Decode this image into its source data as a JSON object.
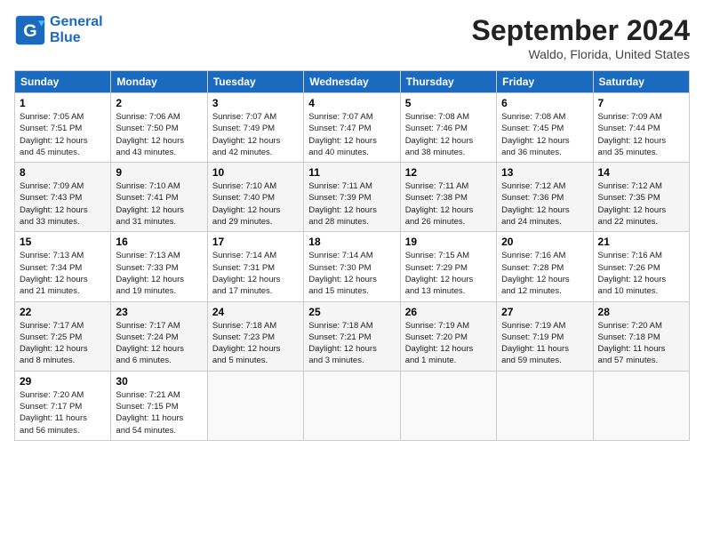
{
  "header": {
    "logo_line1": "General",
    "logo_line2": "Blue",
    "month_title": "September 2024",
    "location": "Waldo, Florida, United States"
  },
  "weekdays": [
    "Sunday",
    "Monday",
    "Tuesday",
    "Wednesday",
    "Thursday",
    "Friday",
    "Saturday"
  ],
  "weeks": [
    [
      {
        "day": "1",
        "sunrise": "7:05 AM",
        "sunset": "7:51 PM",
        "daylight": "12 hours and 45 minutes."
      },
      {
        "day": "2",
        "sunrise": "7:06 AM",
        "sunset": "7:50 PM",
        "daylight": "12 hours and 43 minutes."
      },
      {
        "day": "3",
        "sunrise": "7:07 AM",
        "sunset": "7:49 PM",
        "daylight": "12 hours and 42 minutes."
      },
      {
        "day": "4",
        "sunrise": "7:07 AM",
        "sunset": "7:47 PM",
        "daylight": "12 hours and 40 minutes."
      },
      {
        "day": "5",
        "sunrise": "7:08 AM",
        "sunset": "7:46 PM",
        "daylight": "12 hours and 38 minutes."
      },
      {
        "day": "6",
        "sunrise": "7:08 AM",
        "sunset": "7:45 PM",
        "daylight": "12 hours and 36 minutes."
      },
      {
        "day": "7",
        "sunrise": "7:09 AM",
        "sunset": "7:44 PM",
        "daylight": "12 hours and 35 minutes."
      }
    ],
    [
      {
        "day": "8",
        "sunrise": "7:09 AM",
        "sunset": "7:43 PM",
        "daylight": "12 hours and 33 minutes."
      },
      {
        "day": "9",
        "sunrise": "7:10 AM",
        "sunset": "7:41 PM",
        "daylight": "12 hours and 31 minutes."
      },
      {
        "day": "10",
        "sunrise": "7:10 AM",
        "sunset": "7:40 PM",
        "daylight": "12 hours and 29 minutes."
      },
      {
        "day": "11",
        "sunrise": "7:11 AM",
        "sunset": "7:39 PM",
        "daylight": "12 hours and 28 minutes."
      },
      {
        "day": "12",
        "sunrise": "7:11 AM",
        "sunset": "7:38 PM",
        "daylight": "12 hours and 26 minutes."
      },
      {
        "day": "13",
        "sunrise": "7:12 AM",
        "sunset": "7:36 PM",
        "daylight": "12 hours and 24 minutes."
      },
      {
        "day": "14",
        "sunrise": "7:12 AM",
        "sunset": "7:35 PM",
        "daylight": "12 hours and 22 minutes."
      }
    ],
    [
      {
        "day": "15",
        "sunrise": "7:13 AM",
        "sunset": "7:34 PM",
        "daylight": "12 hours and 21 minutes."
      },
      {
        "day": "16",
        "sunrise": "7:13 AM",
        "sunset": "7:33 PM",
        "daylight": "12 hours and 19 minutes."
      },
      {
        "day": "17",
        "sunrise": "7:14 AM",
        "sunset": "7:31 PM",
        "daylight": "12 hours and 17 minutes."
      },
      {
        "day": "18",
        "sunrise": "7:14 AM",
        "sunset": "7:30 PM",
        "daylight": "12 hours and 15 minutes."
      },
      {
        "day": "19",
        "sunrise": "7:15 AM",
        "sunset": "7:29 PM",
        "daylight": "12 hours and 13 minutes."
      },
      {
        "day": "20",
        "sunrise": "7:16 AM",
        "sunset": "7:28 PM",
        "daylight": "12 hours and 12 minutes."
      },
      {
        "day": "21",
        "sunrise": "7:16 AM",
        "sunset": "7:26 PM",
        "daylight": "12 hours and 10 minutes."
      }
    ],
    [
      {
        "day": "22",
        "sunrise": "7:17 AM",
        "sunset": "7:25 PM",
        "daylight": "12 hours and 8 minutes."
      },
      {
        "day": "23",
        "sunrise": "7:17 AM",
        "sunset": "7:24 PM",
        "daylight": "12 hours and 6 minutes."
      },
      {
        "day": "24",
        "sunrise": "7:18 AM",
        "sunset": "7:23 PM",
        "daylight": "12 hours and 5 minutes."
      },
      {
        "day": "25",
        "sunrise": "7:18 AM",
        "sunset": "7:21 PM",
        "daylight": "12 hours and 3 minutes."
      },
      {
        "day": "26",
        "sunrise": "7:19 AM",
        "sunset": "7:20 PM",
        "daylight": "12 hours and 1 minute."
      },
      {
        "day": "27",
        "sunrise": "7:19 AM",
        "sunset": "7:19 PM",
        "daylight": "11 hours and 59 minutes."
      },
      {
        "day": "28",
        "sunrise": "7:20 AM",
        "sunset": "7:18 PM",
        "daylight": "11 hours and 57 minutes."
      }
    ],
    [
      {
        "day": "29",
        "sunrise": "7:20 AM",
        "sunset": "7:17 PM",
        "daylight": "11 hours and 56 minutes."
      },
      {
        "day": "30",
        "sunrise": "7:21 AM",
        "sunset": "7:15 PM",
        "daylight": "11 hours and 54 minutes."
      },
      null,
      null,
      null,
      null,
      null
    ]
  ]
}
